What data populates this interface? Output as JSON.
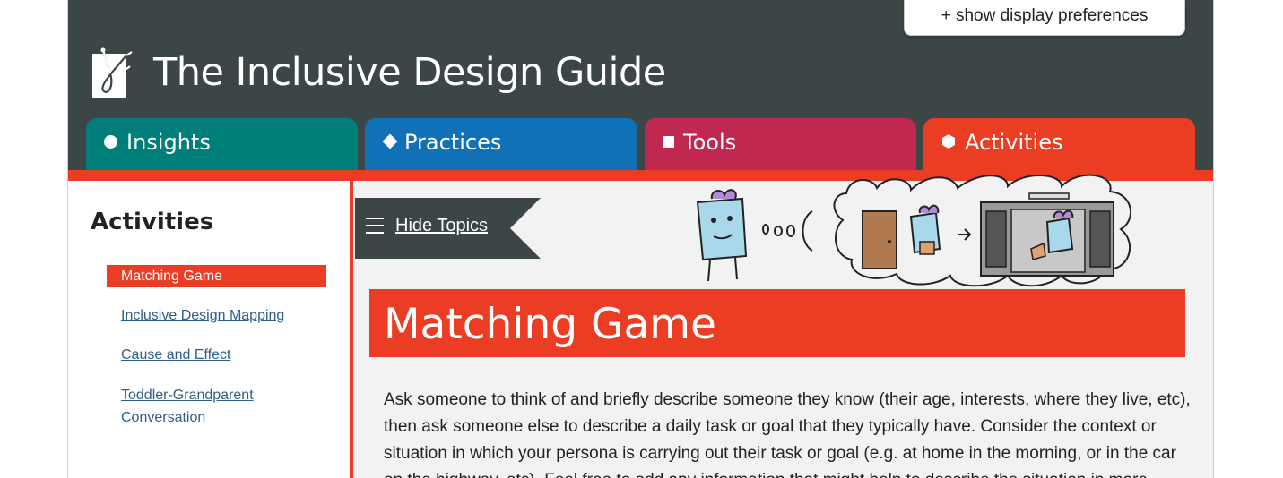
{
  "header": {
    "prefs_label": "+ show display preferences",
    "site_title": "The Inclusive Design Guide",
    "logo_icon": "inclusive-design-logo-icon",
    "colors": {
      "background": "#3c4647",
      "accent": "#ea3d24"
    }
  },
  "tabs": [
    {
      "label": "Insights",
      "icon": "circle-icon",
      "color": "#007f7a"
    },
    {
      "label": "Practices",
      "icon": "diamond-icon",
      "color": "#1071b7"
    },
    {
      "label": "Tools",
      "icon": "square-icon",
      "color": "#c0284f"
    },
    {
      "label": "Activities",
      "icon": "hexagon-icon",
      "color": "#ea3d24",
      "selected": true
    }
  ],
  "sidebar": {
    "title": "Activities",
    "items": [
      {
        "label": "Matching Game",
        "active": true
      },
      {
        "label": "Inclusive Design Mapping",
        "active": false
      },
      {
        "label": "Cause and Effect",
        "active": false
      },
      {
        "label": "Toddler-Grandparent Conversation",
        "active": false
      }
    ]
  },
  "main": {
    "hide_topics_label": "Hide Topics",
    "hide_topics_icon": "menu-icon",
    "illustration": "persona-thinking-illustration",
    "page_title": "Matching Game",
    "body_text": "Ask someone to think of and briefly describe someone they know (their age, interests, where they live, etc), then ask someone else to describe a daily task or goal that they typically have. Consider the context or situation in which your persona is carrying out their task or goal (e.g. at home in the morning, or in the car on the highway, etc). Feel free to add any information that might help to describe the situation in more"
  }
}
